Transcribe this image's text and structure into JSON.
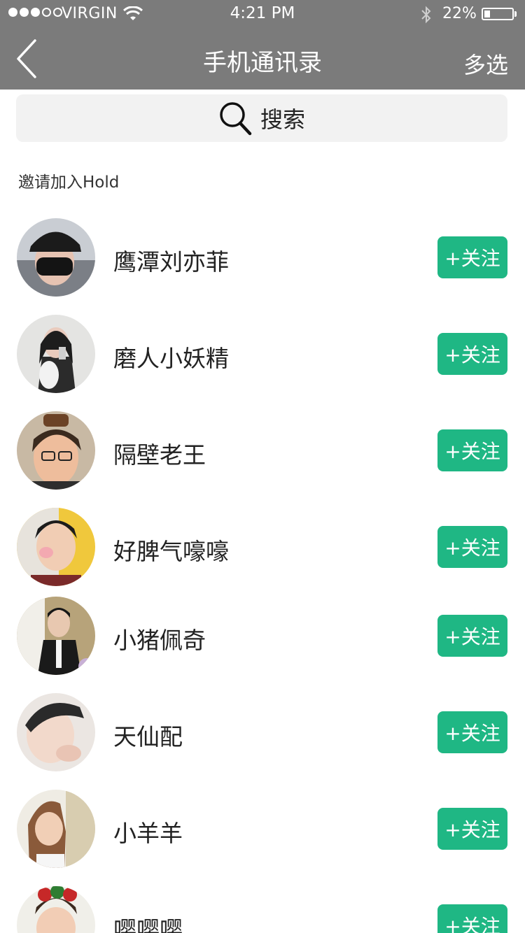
{
  "status_bar": {
    "carrier": "VIRGIN",
    "time": "4:21 PM",
    "battery": "22%",
    "battery_level": 0.22
  },
  "nav": {
    "back_icon": "chevron-left-icon",
    "title": "手机通讯录",
    "multi_select": "多选"
  },
  "search": {
    "icon": "search-icon",
    "label": "搜索"
  },
  "section_title": "邀请加入Hold",
  "colors": {
    "header": "#7b7b7b",
    "accent": "#1fb784",
    "search_bg": "#f2f2f2"
  },
  "contacts": [
    {
      "name": "鹰潭刘亦菲",
      "action": "+关注"
    },
    {
      "name": "磨人小妖精",
      "action": "+关注"
    },
    {
      "name": "隔壁老王",
      "action": "+关注"
    },
    {
      "name": "好脾气嚎嚎",
      "action": "+关注"
    },
    {
      "name": "小猪佩奇",
      "action": "+关注"
    },
    {
      "name": "天仙配",
      "action": "+关注"
    },
    {
      "name": "小羊羊",
      "action": "+关注"
    },
    {
      "name": "嘤嘤嘤",
      "action": "+关注"
    }
  ]
}
